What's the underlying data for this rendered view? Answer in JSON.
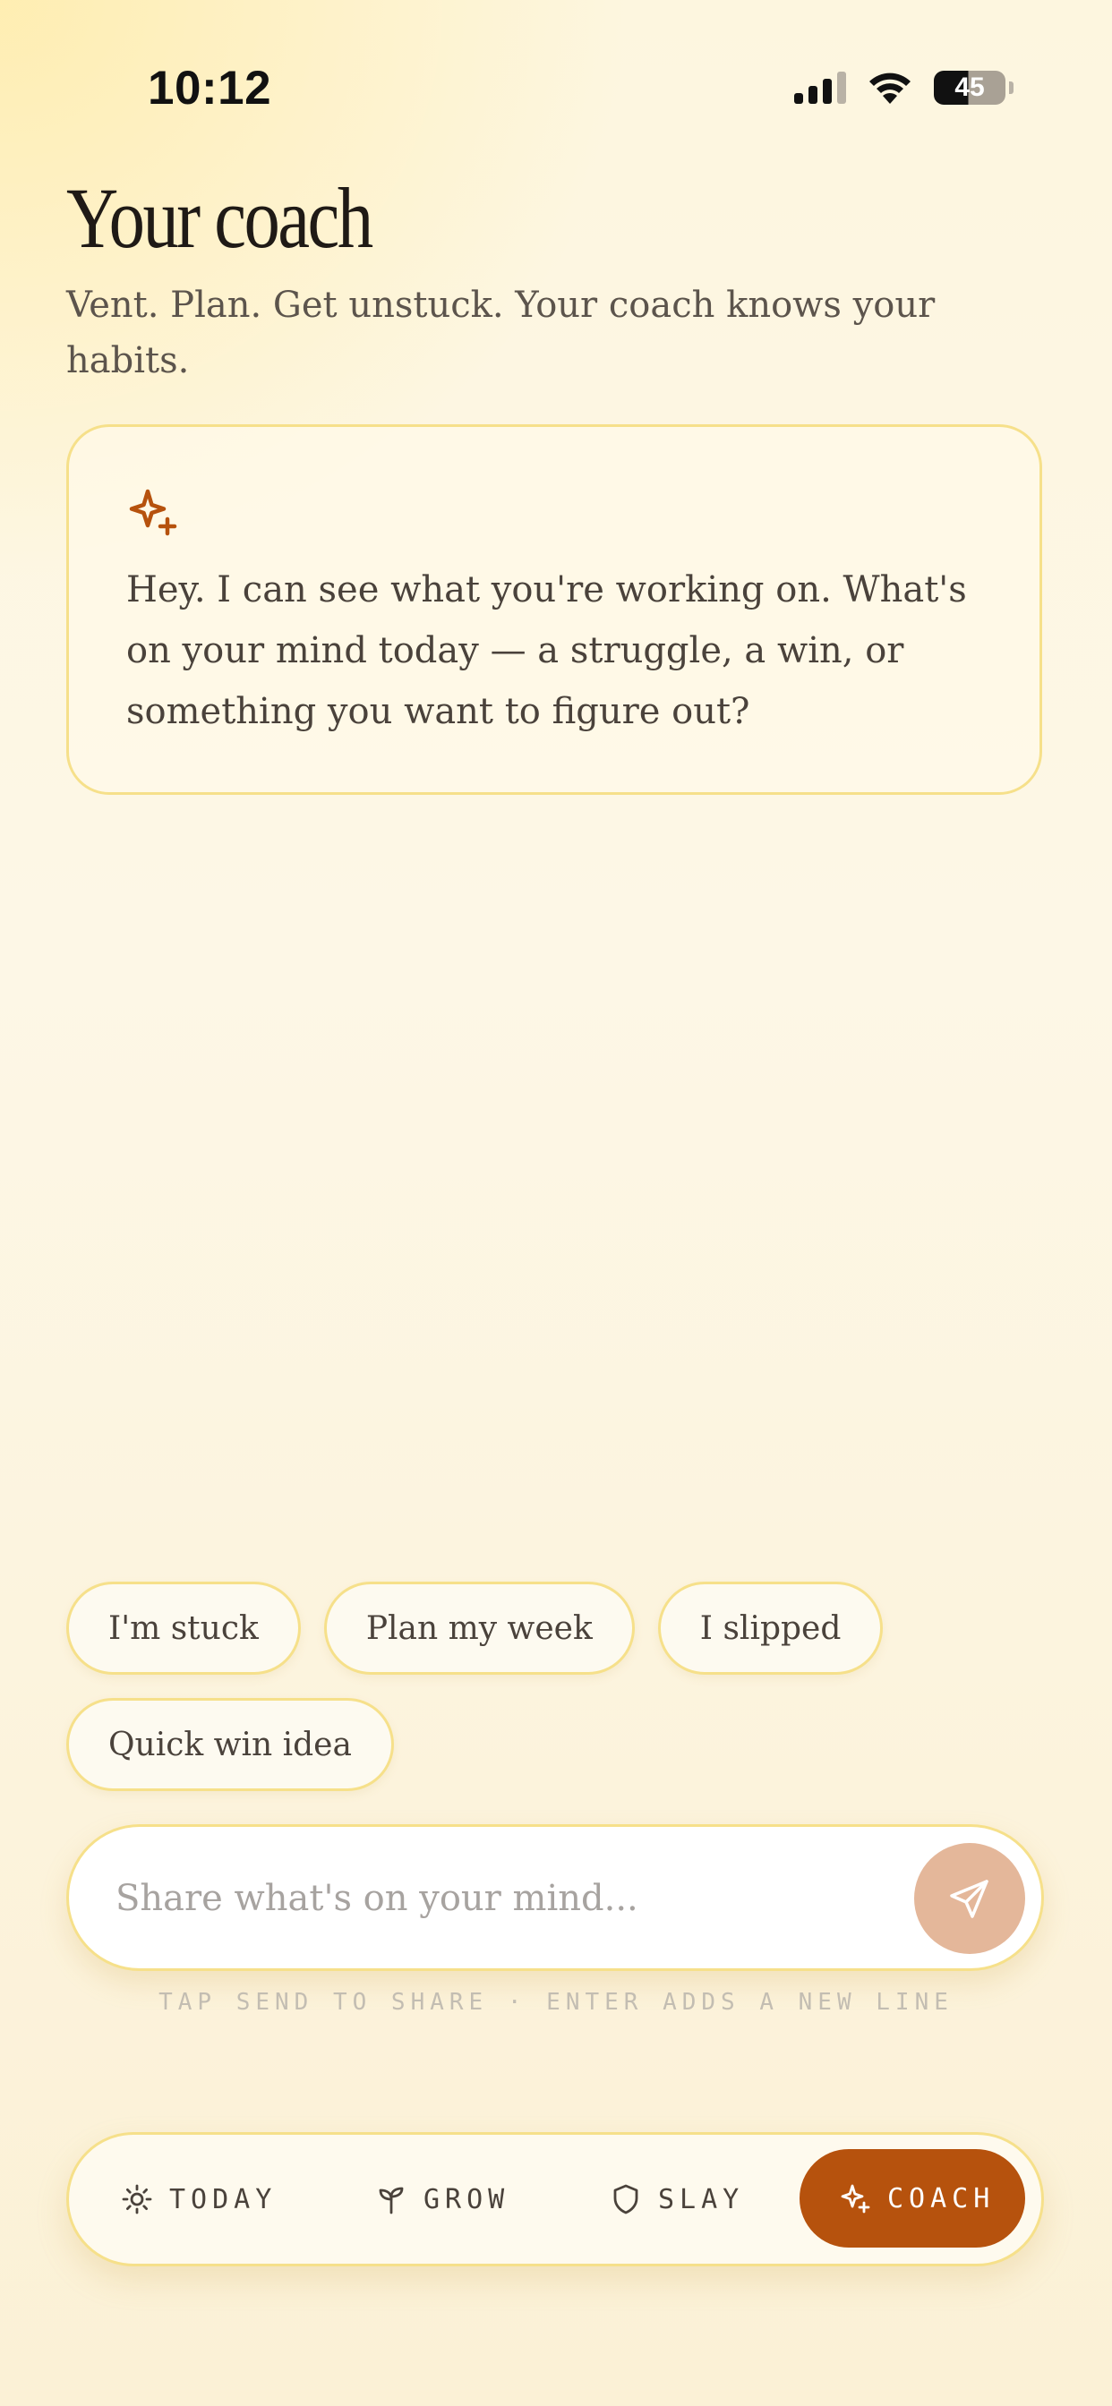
{
  "status_bar": {
    "time": "10:12",
    "battery": "45",
    "icons": [
      "signal-icon",
      "wifi-icon",
      "battery-icon"
    ]
  },
  "header": {
    "title": "Your coach",
    "subtitle": "Vent. Plan. Get unstuck. Your coach knows your habits."
  },
  "coach_card": {
    "icon": "sparkle-icon",
    "message": "Hey. I can see what you're working on. What's on your mind today — a struggle, a win, or something you want to figure out?"
  },
  "quick_replies": [
    {
      "label": "I'm stuck"
    },
    {
      "label": "Plan my week"
    },
    {
      "label": "I slipped"
    },
    {
      "label": "Quick win idea"
    }
  ],
  "composer": {
    "value": "",
    "placeholder": "Share what's on your mind...",
    "hint": "TAP SEND TO SHARE · ENTER ADDS A NEW LINE",
    "send_icon": "send-icon"
  },
  "tabs": [
    {
      "label": "TODAY",
      "icon": "sun-icon",
      "active": false
    },
    {
      "label": "GROW",
      "icon": "sprout-icon",
      "active": false
    },
    {
      "label": "SLAY",
      "icon": "shield-icon",
      "active": false
    },
    {
      "label": "COACH",
      "icon": "sparkle-icon",
      "active": true
    }
  ],
  "colors": {
    "accent": "#b6520d",
    "send_button": "#e4b79a",
    "border": "#f6e08a",
    "background": "#fdf6df"
  }
}
